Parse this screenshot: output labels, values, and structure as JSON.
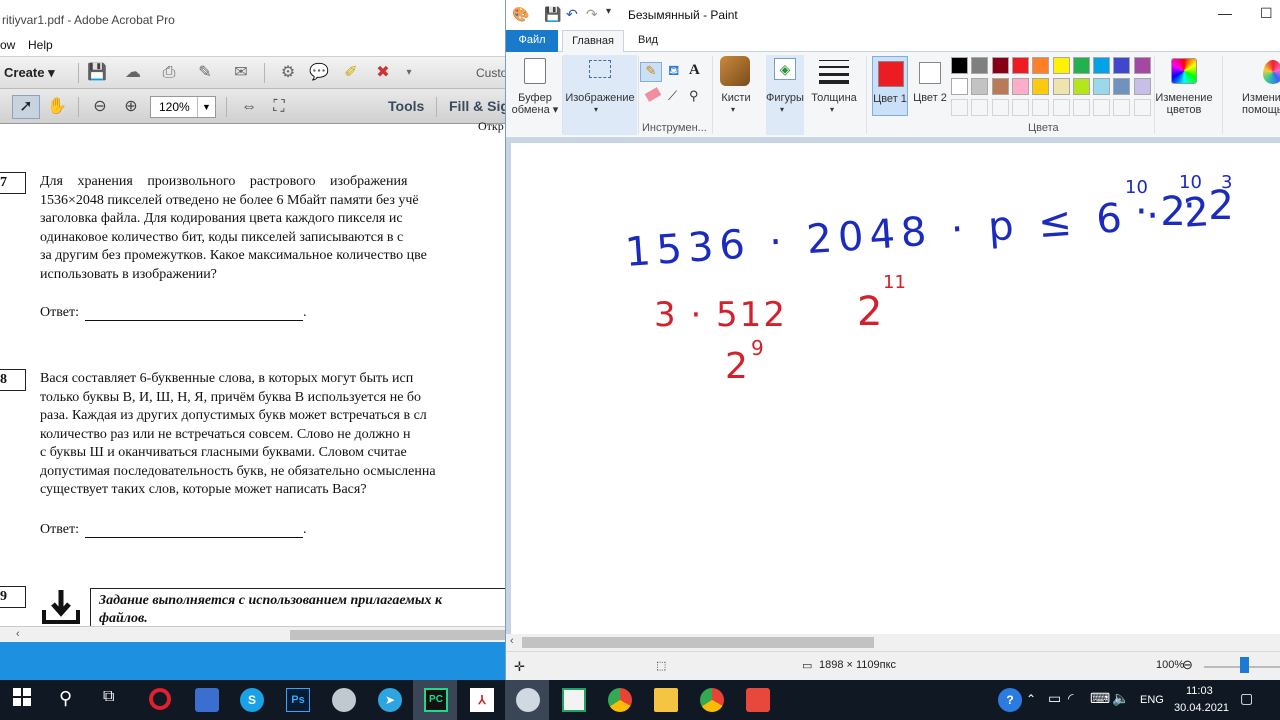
{
  "acrobat": {
    "title": "ritiyvar1.pdf - Adobe Acrobat Pro",
    "menu": [
      "ow",
      "Help"
    ],
    "create_label": "Create",
    "customize_label": "Custo",
    "zoom": "120%",
    "tools_label": "Tools",
    "fill_sign_label": "Fill & Sig",
    "header_fragment": "Откр",
    "q7": {
      "number": "7",
      "lines": [
        "Для хранения произвольного растрового изображения",
        "1536×2048 пикселей отведено не более 6 Мбайт памяти без учё",
        "заголовка файла. Для кодирования цвета каждого пикселя ис",
        "одинаковое количество бит, коды пикселей записываются в с",
        "за другим без промежутков. Какое максимальное количество цве",
        "использовать в изображении?"
      ],
      "answer_label": "Ответ:",
      "answer_end": "."
    },
    "q8": {
      "number": "8",
      "lines": [
        "Вася составляет 6-буквенные слова, в которых могут быть исп",
        "только буквы В, И, Ш, Н, Я, причём буква В используется не бо",
        "раза. Каждая из других допустимых букв может встречаться в сл",
        "количество раз или не встречаться совсем. Слово не должно н",
        "с буквы Ш и оканчиваться гласными буквами. Словом считае",
        "допустимая последовательность букв, не обязательно осмысленна",
        "существует таких слов, которые может написать Вася?"
      ],
      "answer_label": "Ответ:",
      "answer_end": "."
    },
    "q9": {
      "number": "9",
      "lines": [
        "Задание выполняется с использованием прилагаемых к",
        "файлов."
      ]
    }
  },
  "paint": {
    "title": "Безымянный - Paint",
    "tabs": {
      "file": "Файл",
      "home": "Главная",
      "view": "Вид"
    },
    "ribbon": {
      "clipboard": "Буфер обмена",
      "image": "Изображение",
      "tools_group": "Инструмен...",
      "brushes": "Кисти",
      "shapes": "Фигуры",
      "thickness": "Толщина",
      "color1": "Цвет 1",
      "color2": "Цвет 2",
      "colors_group": "Цвета",
      "edit_colors": "Изменение цветов",
      "edit_with": "Измени помощью"
    },
    "palette_row1": [
      "#000000",
      "#7f7f7f",
      "#880015",
      "#ed1c24",
      "#ff7f27",
      "#fff200",
      "#22b14c",
      "#00a2e8",
      "#3f48cc",
      "#a349a4"
    ],
    "palette_row2": [
      "#ffffff",
      "#c3c3c3",
      "#b97a57",
      "#ffaec9",
      "#ffc90e",
      "#efe4b0",
      "#b5e61d",
      "#99d9ea",
      "#7092be",
      "#c8bfe7"
    ],
    "canvas_notes": {
      "blue_expression": "1536 · 2048 · p ≤ 6 · 2",
      "blue_exp_10a": "10",
      "blue_mid": "· 2",
      "blue_exp_10b": "10",
      "blue_end": "· 2",
      "blue_exp_3": "3",
      "red_product": "3 · 512",
      "red_2a": "2",
      "red_exp_11": "11",
      "red_2b": "2",
      "red_exp_9": "9"
    },
    "status": {
      "dimensions": "1898 × 1109пкс",
      "zoom": "100%"
    }
  },
  "taskbar": {
    "language": "ENG",
    "time": "11:03",
    "date": "30.04.2021"
  }
}
